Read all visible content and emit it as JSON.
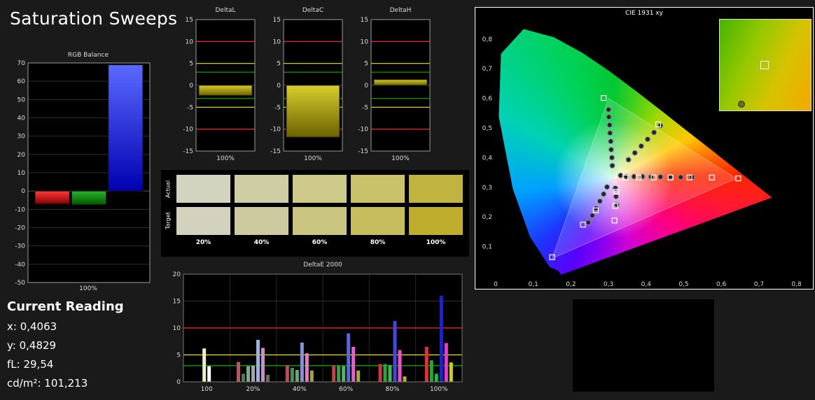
{
  "page": {
    "title": "Saturation Sweeps"
  },
  "colors": {
    "limit_red": "#ff2a2a",
    "limit_yellow": "#e6e600",
    "limit_green": "#00b400",
    "grid": "#2e2e2e",
    "axis": "#9a9a9a",
    "text": "#dddddd"
  },
  "rgb_balance": {
    "title": "RGB Balance",
    "x_label": "100%",
    "ylim": [
      -50,
      70
    ],
    "y_ticks": [
      70,
      60,
      50,
      40,
      30,
      20,
      10,
      0,
      -10,
      -20,
      -30,
      -40,
      -50
    ],
    "bars": [
      {
        "name": "red",
        "value": -7,
        "top": "#ff3a3a",
        "bottom": "#8a0000"
      },
      {
        "name": "green",
        "value": -7.5,
        "top": "#2ab52a",
        "bottom": "#005800"
      },
      {
        "name": "blue",
        "value": 69,
        "top": "#5a6aff",
        "bottom": "#0000b0"
      }
    ]
  },
  "delta_charts": {
    "x_label": "100%",
    "ylim": [
      -15,
      15
    ],
    "y_ticks": [
      15,
      10,
      5,
      0,
      -5,
      -10,
      -15
    ],
    "limits": {
      "red": 10,
      "yellow": 5,
      "green": 3
    },
    "bar_top": "#d8ce2e",
    "bar_bottom": "#6b6200",
    "charts": [
      {
        "title": "DeltaL",
        "value": -2.3
      },
      {
        "title": "DeltaC",
        "value": -11.8
      },
      {
        "title": "DeltaH",
        "value": 1.3
      }
    ]
  },
  "swatch_table": {
    "row_labels": [
      "Actual",
      "Target"
    ],
    "col_labels": [
      "20%",
      "40%",
      "60%",
      "80%",
      "100%"
    ],
    "actual": [
      "#d3d4c0",
      "#cfcda4",
      "#cdc989",
      "#c9c26a",
      "#c1b33f"
    ],
    "target": [
      "#d2d2bf",
      "#cdcaa0",
      "#cbc582",
      "#c6bd5f",
      "#bfae2e"
    ]
  },
  "deltae2000": {
    "title": "DeltaE 2000",
    "ylim": [
      0,
      20
    ],
    "y_ticks": [
      20,
      15,
      10,
      5,
      0
    ],
    "limits": {
      "red": 10,
      "yellow": 5,
      "green": 3
    },
    "groups": [
      {
        "label": "100",
        "bars": [
          {
            "color": "#f0ecca",
            "value": 6.2
          },
          {
            "color": "#ffffff",
            "value": 2.9
          }
        ]
      },
      {
        "label": "20%",
        "bars": [
          {
            "color": "#b45a5a",
            "value": 3.7
          },
          {
            "color": "#4c7a60",
            "value": 1.5
          },
          {
            "color": "#7fa98c",
            "value": 2.9
          },
          {
            "color": "#9fa6ad",
            "value": 3.0
          },
          {
            "color": "#9fb1de",
            "value": 7.8
          },
          {
            "color": "#c98fc6",
            "value": 6.3
          },
          {
            "color": "#6e6e4a",
            "value": 1.3
          }
        ]
      },
      {
        "label": "40%",
        "bars": [
          {
            "color": "#b94f4f",
            "value": 3.1
          },
          {
            "color": "#4f8a57",
            "value": 2.6
          },
          {
            "color": "#6aa973",
            "value": 2.2
          },
          {
            "color": "#8a8fdc",
            "value": 7.3
          },
          {
            "color": "#dc7fc3",
            "value": 5.3
          },
          {
            "color": "#a3a347",
            "value": 2.1
          }
        ]
      },
      {
        "label": "60%",
        "bars": [
          {
            "color": "#bf4444",
            "value": 3.0
          },
          {
            "color": "#3f9a4e",
            "value": 3.0
          },
          {
            "color": "#55b266",
            "value": 2.9
          },
          {
            "color": "#5a66d5",
            "value": 9.0
          },
          {
            "color": "#de66c2",
            "value": 6.5
          },
          {
            "color": "#a8a833",
            "value": 2.1
          }
        ]
      },
      {
        "label": "80%",
        "bars": [
          {
            "color": "#c93a3a",
            "value": 3.3
          },
          {
            "color": "#2fa341",
            "value": 3.3
          },
          {
            "color": "#3fba52",
            "value": 3.1
          },
          {
            "color": "#4646da",
            "value": 11.3
          },
          {
            "color": "#e655c9",
            "value": 5.9
          },
          {
            "color": "#b3b31f",
            "value": 1.0
          }
        ]
      },
      {
        "label": "100%",
        "bars": [
          {
            "color": "#e03030",
            "value": 6.5
          },
          {
            "color": "#22a833",
            "value": 4.0
          },
          {
            "color": "#19c232",
            "value": 1.5
          },
          {
            "color": "#2121cc",
            "value": 16.0
          },
          {
            "color": "#e839da",
            "value": 7.2
          },
          {
            "color": "#cccc19",
            "value": 3.6
          }
        ]
      }
    ]
  },
  "cie": {
    "title": "CIE 1931 xy",
    "x_ticks": [
      "0",
      "0,1",
      "0,2",
      "0,3",
      "0,4",
      "0,5",
      "0,6",
      "0,7",
      "0,8"
    ],
    "y_ticks": [
      "0,8",
      "0,7",
      "0,6",
      "0,5",
      "0,4",
      "0,3",
      "0,2",
      "0,1"
    ],
    "gamut_triangle": [
      [
        0.64,
        0.33
      ],
      [
        0.3,
        0.6
      ],
      [
        0.15,
        0.06
      ]
    ],
    "targets": [
      [
        0.345,
        0.333
      ],
      [
        0.38,
        0.333
      ],
      [
        0.42,
        0.333
      ],
      [
        0.465,
        0.333
      ],
      [
        0.515,
        0.333
      ],
      [
        0.575,
        0.333
      ],
      [
        0.645,
        0.33
      ],
      [
        0.287,
        0.601
      ],
      [
        0.432,
        0.512
      ],
      [
        0.321,
        0.285
      ],
      [
        0.318,
        0.237
      ],
      [
        0.316,
        0.188
      ],
      [
        0.266,
        0.222
      ],
      [
        0.232,
        0.174
      ],
      [
        0.15,
        0.064
      ]
    ],
    "measurements": [
      [
        0.332,
        0.34
      ],
      [
        0.347,
        0.336
      ],
      [
        0.368,
        0.336
      ],
      [
        0.39,
        0.336
      ],
      [
        0.413,
        0.335
      ],
      [
        0.438,
        0.335
      ],
      [
        0.464,
        0.335
      ],
      [
        0.492,
        0.334
      ],
      [
        0.522,
        0.334
      ],
      [
        0.31,
        0.373
      ],
      [
        0.309,
        0.4
      ],
      [
        0.307,
        0.427
      ],
      [
        0.306,
        0.455
      ],
      [
        0.304,
        0.483
      ],
      [
        0.303,
        0.51
      ],
      [
        0.301,
        0.537
      ],
      [
        0.3,
        0.562
      ],
      [
        0.353,
        0.393
      ],
      [
        0.37,
        0.416
      ],
      [
        0.387,
        0.439
      ],
      [
        0.404,
        0.462
      ],
      [
        0.421,
        0.485
      ],
      [
        0.438,
        0.508
      ],
      [
        0.296,
        0.301
      ],
      [
        0.287,
        0.277
      ],
      [
        0.277,
        0.253
      ],
      [
        0.267,
        0.229
      ],
      [
        0.257,
        0.205
      ],
      [
        0.246,
        0.181
      ],
      [
        0.318,
        0.297
      ],
      [
        0.32,
        0.269
      ],
      [
        0.322,
        0.241
      ]
    ],
    "inset": {
      "square": [
        0.49,
        0.5
      ],
      "circle": [
        0.24,
        0.93
      ]
    }
  },
  "current_reading": {
    "heading": "Current Reading",
    "x": "x: 0,4063",
    "y": "y: 0,4829",
    "fl": "fL: 29,54",
    "cdm2": "cd/m²: 101,213"
  }
}
